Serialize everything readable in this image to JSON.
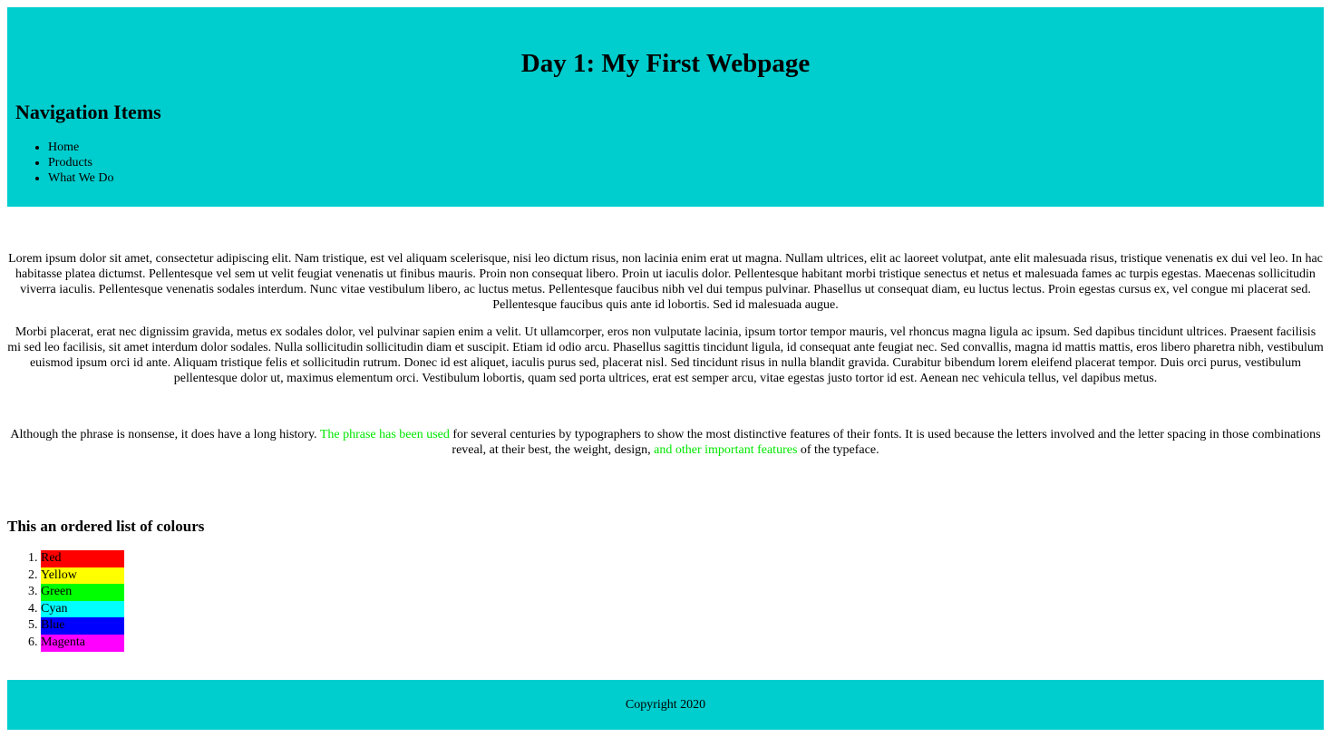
{
  "header": {
    "title": "Day 1: My First Webpage",
    "nav_heading": "Navigation Items",
    "nav_items": [
      "Home",
      "Products",
      "What We Do"
    ],
    "background_color": "#00cdcd"
  },
  "main": {
    "paragraph_1": "Lorem ipsum dolor sit amet, consectetur adipiscing elit. Nam tristique, est vel aliquam scelerisque, nisi leo dictum risus, non lacinia enim erat ut magna. Nullam ultrices, elit ac laoreet volutpat, ante elit malesuada risus, tristique venenatis ex dui vel leo. In hac habitasse platea dictumst. Pellentesque vel sem ut velit feugiat venenatis ut finibus mauris. Proin non consequat libero. Proin ut iaculis dolor. Pellentesque habitant morbi tristique senectus et netus et malesuada fames ac turpis egestas. Maecenas sollicitudin viverra iaculis. Pellentesque venenatis sodales interdum. Nunc vitae vestibulum libero, ac luctus metus. Pellentesque faucibus nibh vel dui tempus pulvinar. Phasellus ut consequat diam, eu luctus lectus. Proin egestas cursus ex, vel congue mi placerat sed. Pellentesque faucibus quis ante id lobortis. Sed id malesuada augue.",
    "paragraph_2": "Morbi placerat, erat nec dignissim gravida, metus ex sodales dolor, vel pulvinar sapien enim a velit. Ut ullamcorper, eros non vulputate lacinia, ipsum tortor tempor mauris, vel rhoncus magna ligula ac ipsum. Sed dapibus tincidunt ultrices. Praesent facilisis mi sed leo facilisis, sit amet interdum dolor sodales. Nulla sollicitudin sollicitudin diam et suscipit. Etiam id odio arcu. Phasellus sagittis tincidunt ligula, id consequat ante feugiat nec. Sed convallis, magna id mattis mattis, eros libero pharetra nibh, vestibulum euismod ipsum orci id ante. Aliquam tristique felis et sollicitudin rutrum. Donec id est aliquet, iaculis purus sed, placerat nisl. Sed tincidunt risus in nulla blandit gravida. Curabitur bibendum lorem eleifend placerat tempor. Duis orci purus, vestibulum pellentesque dolor ut, maximus elementum orci. Vestibulum lobortis, quam sed porta ultrices, erat est semper arcu, vitae egestas justo tortor id est. Aenean nec vehicula tellus, vel dapibus metus.",
    "paragraph_3": {
      "part_1": "Although the phrase is nonsense, it does have a long history. ",
      "highlight_1": "The phrase has been used",
      "part_2": " for several centuries by typographers to show the most distinctive features of their fonts. It is used because the letters involved and the letter spacing in those combinations reveal, at their best, the weight, design, ",
      "highlight_2": "and other important features",
      "part_3": " of the typeface.",
      "highlight_color": "#00e600"
    },
    "colours_heading": "This an ordered list of colours",
    "colours": [
      {
        "label": "Red",
        "color": "#ff0000"
      },
      {
        "label": "Yellow",
        "color": "#ffff00"
      },
      {
        "label": "Green",
        "color": "#00ff00"
      },
      {
        "label": "Cyan",
        "color": "#00ffff"
      },
      {
        "label": "Blue",
        "color": "#0000ff"
      },
      {
        "label": "Magenta",
        "color": "#ff00ff"
      }
    ]
  },
  "footer": {
    "copyright": "Copyright 2020"
  }
}
